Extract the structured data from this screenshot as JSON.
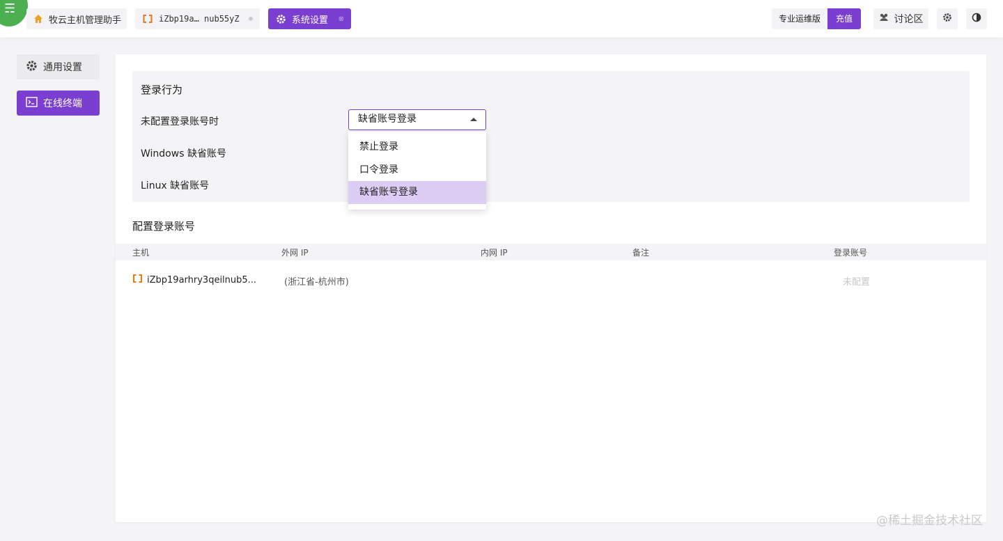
{
  "tabs": {
    "home": {
      "label": "牧云主机管理助手",
      "icon": "home-icon"
    },
    "host": {
      "label": "iZbp19a… nub55yZ",
      "icon": "host-bracket-icon"
    },
    "settings": {
      "label": "系统设置",
      "icon": "gear-icon"
    }
  },
  "header": {
    "edition_label": "专业运维版",
    "charge_label": "充值",
    "forum_label": "讨论区"
  },
  "sidebar": {
    "items": [
      {
        "label": "通用设置",
        "icon": "gear-icon"
      },
      {
        "label": "在线终端",
        "icon": "terminal-icon"
      }
    ]
  },
  "login_behavior": {
    "title": "登录行为",
    "rows": [
      {
        "label": "未配置登录账号时"
      },
      {
        "label": "Windows 缺省账号"
      },
      {
        "label": "Linux 缺省账号"
      }
    ],
    "select_value": "缺省账号登录",
    "options": [
      "禁止登录",
      "口令登录",
      "缺省账号登录"
    ]
  },
  "accounts": {
    "title": "配置登录账号",
    "columns": [
      "主机",
      "外网 IP",
      "内网 IP",
      "备注",
      "登录账号"
    ],
    "rows": [
      {
        "host": "iZbp19arhry3qeilnub5...",
        "public_ip": "(浙江省-杭州市)",
        "private_ip": "",
        "note": "",
        "account": "未配置"
      }
    ]
  },
  "watermark": "@稀土掘金技术社区",
  "colors": {
    "accent": "#7a3fd1",
    "logo": "#4caf50",
    "host_icon": "#e07a1a",
    "home_icon": "#f0a020"
  }
}
